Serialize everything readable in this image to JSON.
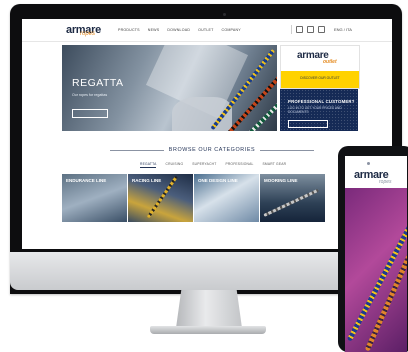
{
  "site": {
    "logo": "armare",
    "logo_sub": "ropes",
    "nav": [
      "PRODUCTS",
      "NEWS",
      "DOWNLOAD",
      "OUTLET",
      "COMPANY"
    ],
    "lang": "ENG / ITA"
  },
  "hero": {
    "title": "REGATTA",
    "text": "Our ropes for regattas",
    "icon": "rope-photo"
  },
  "promo": {
    "logo": "armare",
    "sub": "outlet",
    "text": "DISCOVER OUR OUTLET"
  },
  "pro": {
    "title": "PROFESSIONAL CUSTOMER?",
    "text": "LOG IN TO GET YOUR PRICES AND DOCUMENTS"
  },
  "browse": {
    "title": "BROWSE OUR CATEGORIES",
    "tabs": [
      "REGATTA",
      "CRUISING",
      "SUPERYACHT",
      "PROFESSIONAL",
      "SMART GEAR"
    ],
    "categories": [
      "ENDURANCE LINE",
      "RACING LINE",
      "ONE DESIGN LINE",
      "MOORING LINE"
    ]
  },
  "phone": {
    "logo": "armare",
    "logo_sub": "ropes"
  },
  "colors": {
    "brand_navy": "#1d2a44",
    "accent_orange": "#e48a1f",
    "outlet_yellow": "#ffd200",
    "pro_blue": "#152a56",
    "phone_hero": "#b2499a"
  }
}
